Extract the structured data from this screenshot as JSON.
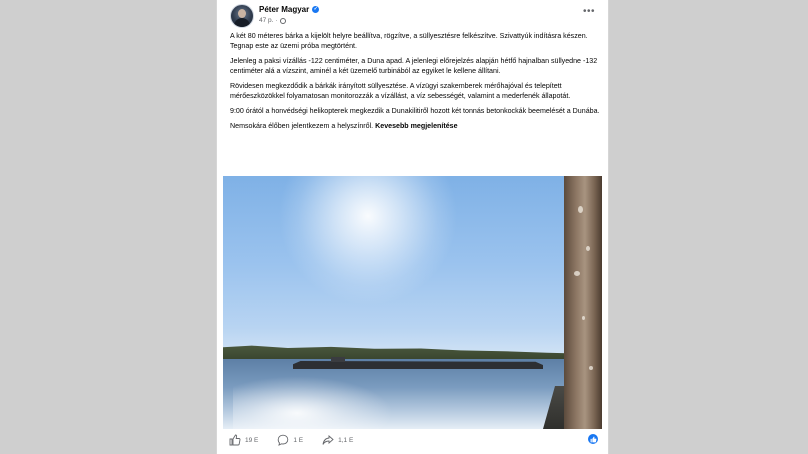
{
  "post": {
    "author": "Péter Magyar",
    "time": "47 p.",
    "paragraphs": [
      "A két 80 méteres bárka a kijelölt helyre beállítva, rögzítve, a süllyesztésre felkészítve. Szivattyúk indításra készen. Tegnap este az üzemi próba megtörtént.",
      "Jelenleg a paksi vízállás -122 centiméter, a Duna apad. A jelenlegi előrejelzés alapján hétfő hajnalban süllyedne -132 centiméter alá a vízszint, aminél a két üzemelő turbinából az egyiket le kellene állítani.",
      "Rövidesen megkezdődik a bárkák irányított süllyesztése. A vízügyi szakemberek mérőhajóval és telepített mérőeszközökkel folyamatosan monitorozzák a vízállást, a víz sebességét, valamint a mederfenék állapotát.",
      "9:00 órától a honvédségi helikopterek megkezdik a Dunakilitiről hozott két tonnás betonkockák beemelését a Dunába."
    ],
    "last_paragraph": "Nemsokára élőben jelentkezem a helyszínről.",
    "see_less": "Kevesebb megjelenítése"
  },
  "actions": {
    "likes": "19 E",
    "comments": "1 E",
    "shares": "1,1 E"
  },
  "colors": {
    "accent": "#1877f2",
    "secondary_text": "#65676b"
  },
  "icons": [
    "avatar",
    "verified-badge-icon",
    "globe-icon",
    "more-options-icon",
    "like-icon",
    "comment-icon",
    "share-icon",
    "reaction-like-icon"
  ]
}
